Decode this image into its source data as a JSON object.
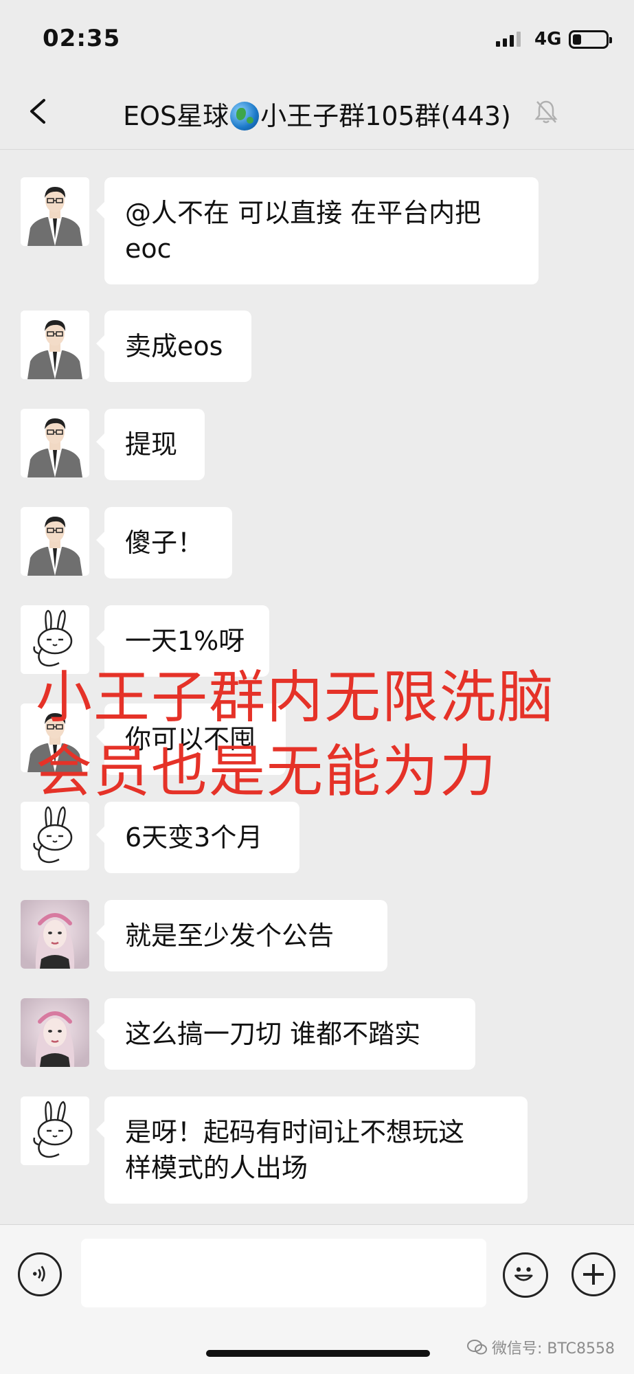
{
  "status_bar": {
    "time": "02:35",
    "network": "4G",
    "battery_level": 0.25
  },
  "nav": {
    "title_prefix": "EOS星球",
    "title_suffix": "小王子群105群(443)",
    "globe_icon": "globe-emoji-icon",
    "mute_icon": "bell-slash-icon"
  },
  "messages": [
    {
      "avatar": "man-in-suit-avatar",
      "lines": [
        "@人不在 可以直接 在平台内把",
        "eoc"
      ]
    },
    {
      "avatar": "man-in-suit-avatar",
      "lines": [
        "卖成eos"
      ]
    },
    {
      "avatar": "man-in-suit-avatar",
      "lines": [
        "提现"
      ]
    },
    {
      "avatar": "man-in-suit-avatar",
      "lines": [
        "傻子！"
      ]
    },
    {
      "avatar": "rabbit-avatar",
      "lines": [
        "一天1%呀"
      ]
    },
    {
      "avatar": "man-in-suit-avatar",
      "lines": [
        "你可以不囤"
      ]
    },
    {
      "avatar": "rabbit-avatar",
      "lines": [
        "6天变3个月"
      ]
    },
    {
      "avatar": "woman-avatar",
      "lines": [
        "就是至少发个公告"
      ]
    },
    {
      "avatar": "woman-avatar",
      "lines": [
        "这么搞一刀切 谁都不踏实"
      ]
    },
    {
      "avatar": "rabbit-avatar",
      "lines": [
        "是呀！起码有时间让不想玩这",
        "样模式的人出场"
      ]
    }
  ],
  "overlay": {
    "line1": "小王子群内无限洗脑",
    "line2": "会员也是无能为力",
    "color": "#e53228"
  },
  "input_bar": {
    "voice_icon": "voice-icon",
    "emoji_icon": "emoji-icon",
    "plus_icon": "plus-icon",
    "text": ""
  },
  "watermark": "微信号: BTC8558"
}
